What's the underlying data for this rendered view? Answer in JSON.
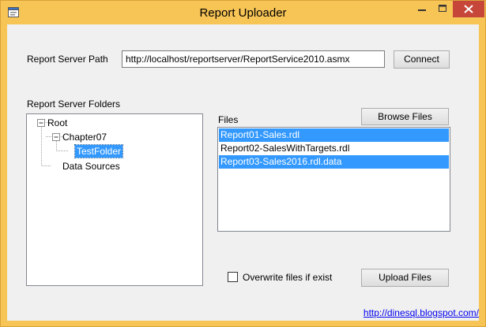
{
  "window": {
    "title": "Report Uploader"
  },
  "server_path": {
    "label": "Report Server Path",
    "value": "http://localhost/reportserver/ReportService2010.asmx",
    "connect_label": "Connect"
  },
  "folders": {
    "label": "Report Server Folders",
    "nodes": [
      {
        "label": "Root",
        "state": "expanded"
      },
      {
        "label": "Chapter07",
        "state": "expanded"
      },
      {
        "label": "TestFolder",
        "state": "selected"
      },
      {
        "label": "Data Sources",
        "state": "leaf"
      }
    ]
  },
  "files": {
    "label": "Files",
    "browse_label": "Browse Files",
    "items": [
      {
        "name": "Report01-Sales.rdl",
        "selected": true
      },
      {
        "name": "Report02-SalesWithTargets.rdl",
        "selected": false
      },
      {
        "name": "Report03-Sales2016.rdl.data",
        "selected": true
      }
    ]
  },
  "overwrite": {
    "label": "Overwrite files if exist",
    "checked": false
  },
  "upload_label": "Upload Files",
  "footer_link": "http://dinesql.blogspot.com/",
  "colors": {
    "title_bar": "#f7c456",
    "close_button": "#c7463a",
    "selection": "#3399ff",
    "link": "#0000ee"
  }
}
